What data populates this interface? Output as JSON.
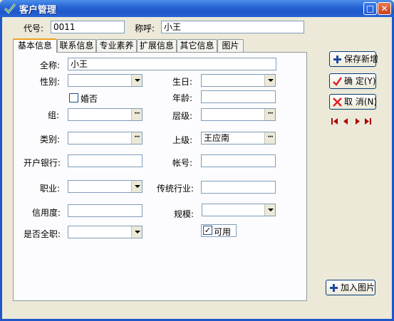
{
  "window": {
    "title": "客户管理"
  },
  "header": {
    "code_label": "代号:",
    "code_value": "0011",
    "nickname_label": "称呼:",
    "nickname_value": "小王"
  },
  "tabs": [
    "基本信息",
    "联系信息",
    "专业素养",
    "扩展信息",
    "其它信息",
    "图片"
  ],
  "form": {
    "fullname_label": "全称:",
    "fullname_value": "小王",
    "gender_label": "性别:",
    "birthday_label": "生日:",
    "married_label": "婚否",
    "age_label": "年龄:",
    "group_label": "组:",
    "level_label": "层级:",
    "category_label": "类别:",
    "superior_label": "上级:",
    "superior_value": "王应南",
    "bank_label": "开户银行:",
    "account_label": "帐号:",
    "job_label": "职业:",
    "industry_label": "传统行业:",
    "credit_label": "信用度:",
    "scale_label": "规模:",
    "fulltime_label": "是否全职:",
    "enabled_label": "可用",
    "enabled_checked": true
  },
  "buttons": {
    "save_new": "保存新增",
    "confirm": "确 定(Y)",
    "cancel": "取 消(N)",
    "add_picture": "加入图片"
  }
}
